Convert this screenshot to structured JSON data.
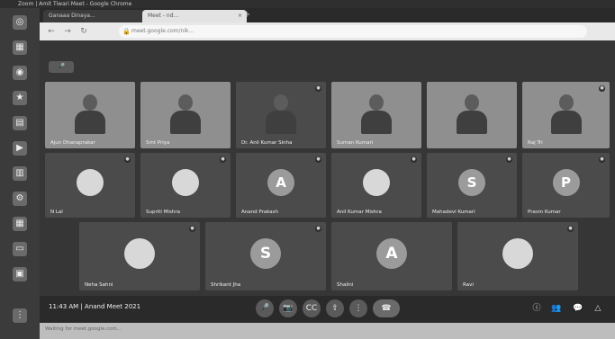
{
  "os": {
    "title": "Zoom | Amit Tiwari Meet - Google Chrome"
  },
  "browser": {
    "tabs": [
      {
        "label": "Ganaaa Dinaya..."
      },
      {
        "label": "Meet - nd..."
      }
    ],
    "address": "meet.google.com/nik..."
  },
  "meeting": {
    "mic_label": "🎤",
    "tiles": [
      {
        "name": "Ajun Dhanaprakar",
        "kind": "video"
      },
      {
        "name": "Smt Priya",
        "kind": "video"
      },
      {
        "name": "Dr. Anil Kumar Sinha",
        "kind": "video"
      },
      {
        "name": "Suman Kumari",
        "kind": "video"
      },
      {
        "name": "",
        "kind": "video"
      },
      {
        "name": "Raj Tri",
        "kind": "video"
      },
      {
        "name": "N Lal",
        "kind": "photo",
        "initial": ""
      },
      {
        "name": "Supriti Mishra",
        "kind": "photo",
        "initial": ""
      },
      {
        "name": "Anand Prakash",
        "kind": "initial",
        "initial": "A"
      },
      {
        "name": "Anil Kumar Mishra",
        "kind": "photo",
        "initial": ""
      },
      {
        "name": "Mahadevi Kumari",
        "kind": "initial",
        "initial": "S"
      },
      {
        "name": "Pravin Kumar",
        "kind": "initial",
        "initial": "P"
      },
      {
        "name": "Neha Sahni",
        "kind": "photo",
        "initial": ""
      },
      {
        "name": "Shrikant Jha",
        "kind": "initial",
        "initial": "S"
      },
      {
        "name": "Shalini",
        "kind": "initial",
        "initial": "A"
      },
      {
        "name": "Ravi",
        "kind": "photo",
        "initial": ""
      }
    ],
    "clock": "11:43 AM  |  Anand Meet 2021",
    "controls": {
      "mic": "🎤",
      "camera": "📷",
      "captions": "CC",
      "present": "⇧",
      "more": "⋮",
      "end": "☎"
    },
    "right_icons": {
      "info": "ⓘ",
      "people": "👥",
      "chat": "💬",
      "activities": "△"
    }
  },
  "status": {
    "text": "Waiting for meet.google.com..."
  }
}
